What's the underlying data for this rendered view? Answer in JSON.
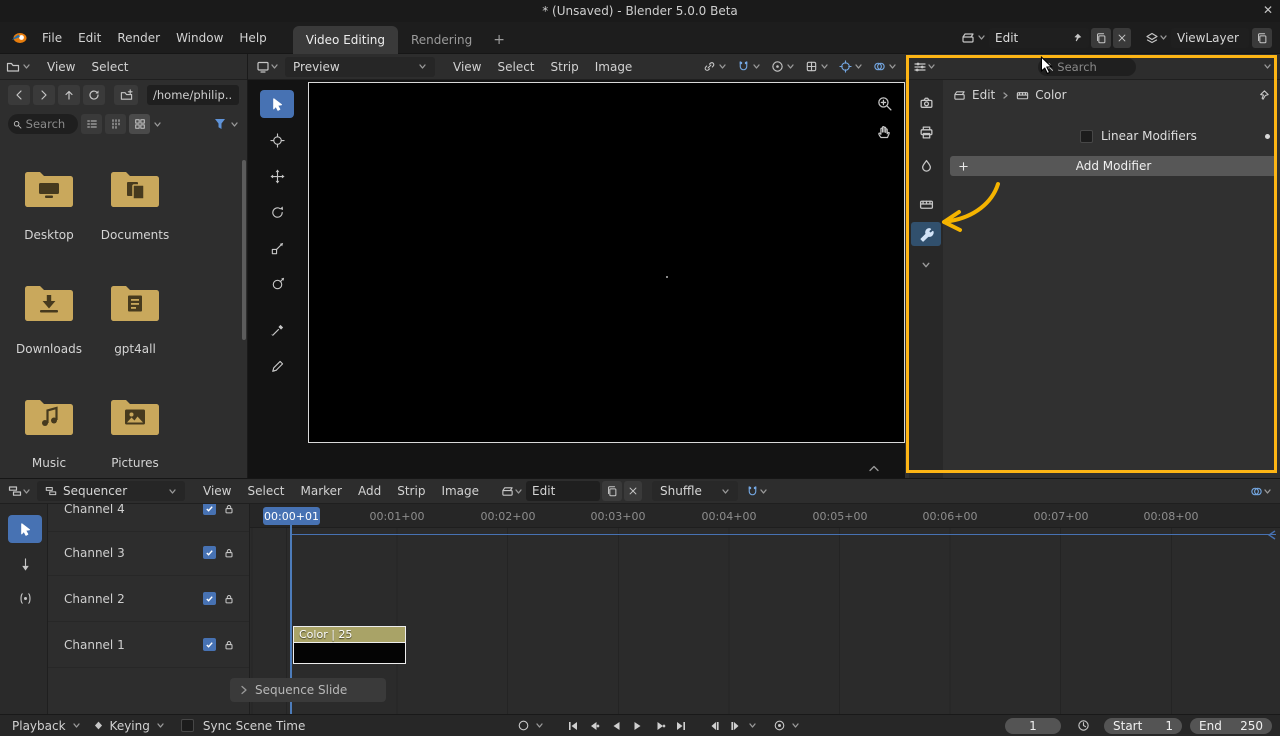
{
  "colors": {
    "accent": "#4772b3",
    "annotation": "#ffb400",
    "folder": "#c9a85c",
    "strip_header": "#a9a367"
  },
  "titlebar": {
    "title": "* (Unsaved) - Blender 5.0.0 Beta",
    "close": "✕"
  },
  "menubar": {
    "menus": [
      "File",
      "Edit",
      "Render",
      "Window",
      "Help"
    ],
    "tabs": [
      "Video Editing",
      "Rendering"
    ],
    "add_tab": "+",
    "scene_value": "Edit",
    "viewlayer_value": "ViewLayer"
  },
  "filebrowser": {
    "menus": [
      "View",
      "Select"
    ],
    "path": "/home/philip...",
    "search_placeholder": "Search",
    "folders": [
      "Desktop",
      "Documents",
      "Downloads",
      "gpt4all",
      "Music",
      "Pictures"
    ]
  },
  "preview": {
    "editor_label": "Preview",
    "menus": [
      "View",
      "Select",
      "Strip",
      "Image"
    ]
  },
  "properties": {
    "search_placeholder": "Search",
    "breadcrumb_scene": "Edit",
    "breadcrumb_item": "Color",
    "linear_modifiers_label": "Linear Modifiers",
    "add_modifier_label": "Add Modifier"
  },
  "sequencer": {
    "editor_label": "Sequencer",
    "menus": [
      "View",
      "Select",
      "Marker",
      "Add",
      "Strip",
      "Image"
    ],
    "scene_value": "Edit",
    "channel_mode": "Shuffle",
    "channels": [
      "Channel 4",
      "Channel 3",
      "Channel 2",
      "Channel 1"
    ],
    "current_frame": "00:00+01",
    "ruler": [
      "00:01+00",
      "00:02+00",
      "00:03+00",
      "00:04+00",
      "00:05+00",
      "00:06+00",
      "00:07+00",
      "00:08+00"
    ],
    "strip_label": "Color | 25",
    "panel_toggle": "Sequence Slide"
  },
  "statusbar": {
    "playback": "Playback",
    "keying": "Keying",
    "sync_label": "Sync Scene Time",
    "frame_value": "1",
    "start_label": "Start",
    "start_value": "1",
    "end_label": "End",
    "end_value": "250"
  }
}
